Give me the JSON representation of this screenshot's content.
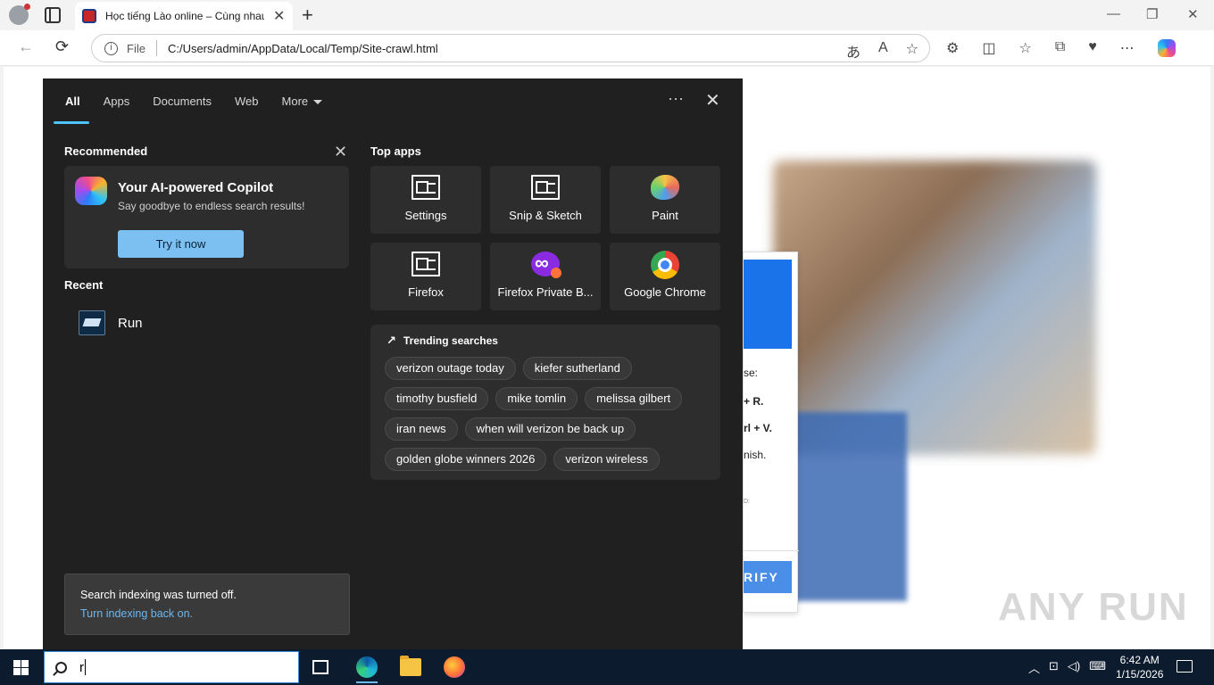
{
  "browser": {
    "tab_title": "Học tiếng Lào online – Cùng nhau",
    "tab_close": "✕",
    "new_tab": "+",
    "file_label": "File",
    "url": "C:/Users/admin/AppData/Local/Temp/Site-crawl.html",
    "window_controls": [
      "—",
      "❐",
      "✕"
    ]
  },
  "page_behind": {
    "dialog_lines": [
      "se:",
      "+ R.",
      "rl + V.",
      "nish.",
      "D:"
    ],
    "verify_label": "RIFY",
    "watermark": "ANY RUN"
  },
  "search_panel": {
    "tabs": [
      "All",
      "Apps",
      "Documents",
      "Web",
      "More"
    ],
    "more_options": "···",
    "close": "✕",
    "recommended_title": "Recommended",
    "copilot": {
      "title": "Your AI-powered Copilot",
      "subtitle": "Say goodbye to endless search results!",
      "button": "Try it now"
    },
    "recent_title": "Recent",
    "recent_items": [
      {
        "label": "Run",
        "icon": "run-icon"
      }
    ],
    "top_apps_title": "Top apps",
    "top_apps": [
      {
        "label": "Settings",
        "icon": "settings-icon"
      },
      {
        "label": "Snip & Sketch",
        "icon": "snip-sketch-icon"
      },
      {
        "label": "Paint",
        "icon": "paint-icon"
      },
      {
        "label": "Firefox",
        "icon": "firefox-generic-icon"
      },
      {
        "label": "Firefox Private B...",
        "icon": "firefox-private-icon"
      },
      {
        "label": "Google Chrome",
        "icon": "chrome-icon"
      }
    ],
    "trending_title": "Trending searches",
    "trending": [
      "verizon outage today",
      "kiefer sutherland",
      "timothy busfield",
      "mike tomlin",
      "melissa gilbert",
      "iran news",
      "when will verizon be back up",
      "golden globe winners 2026",
      "verizon wireless"
    ],
    "indexing_message": "Search indexing was turned off.",
    "indexing_link": "Turn indexing back on."
  },
  "taskbar": {
    "search_text": "r",
    "tray_icons": [
      "chevron-up-icon",
      "network-icon",
      "volume-icon",
      "input-icon"
    ],
    "time": "6:42 AM",
    "date": "1/15/2026"
  }
}
